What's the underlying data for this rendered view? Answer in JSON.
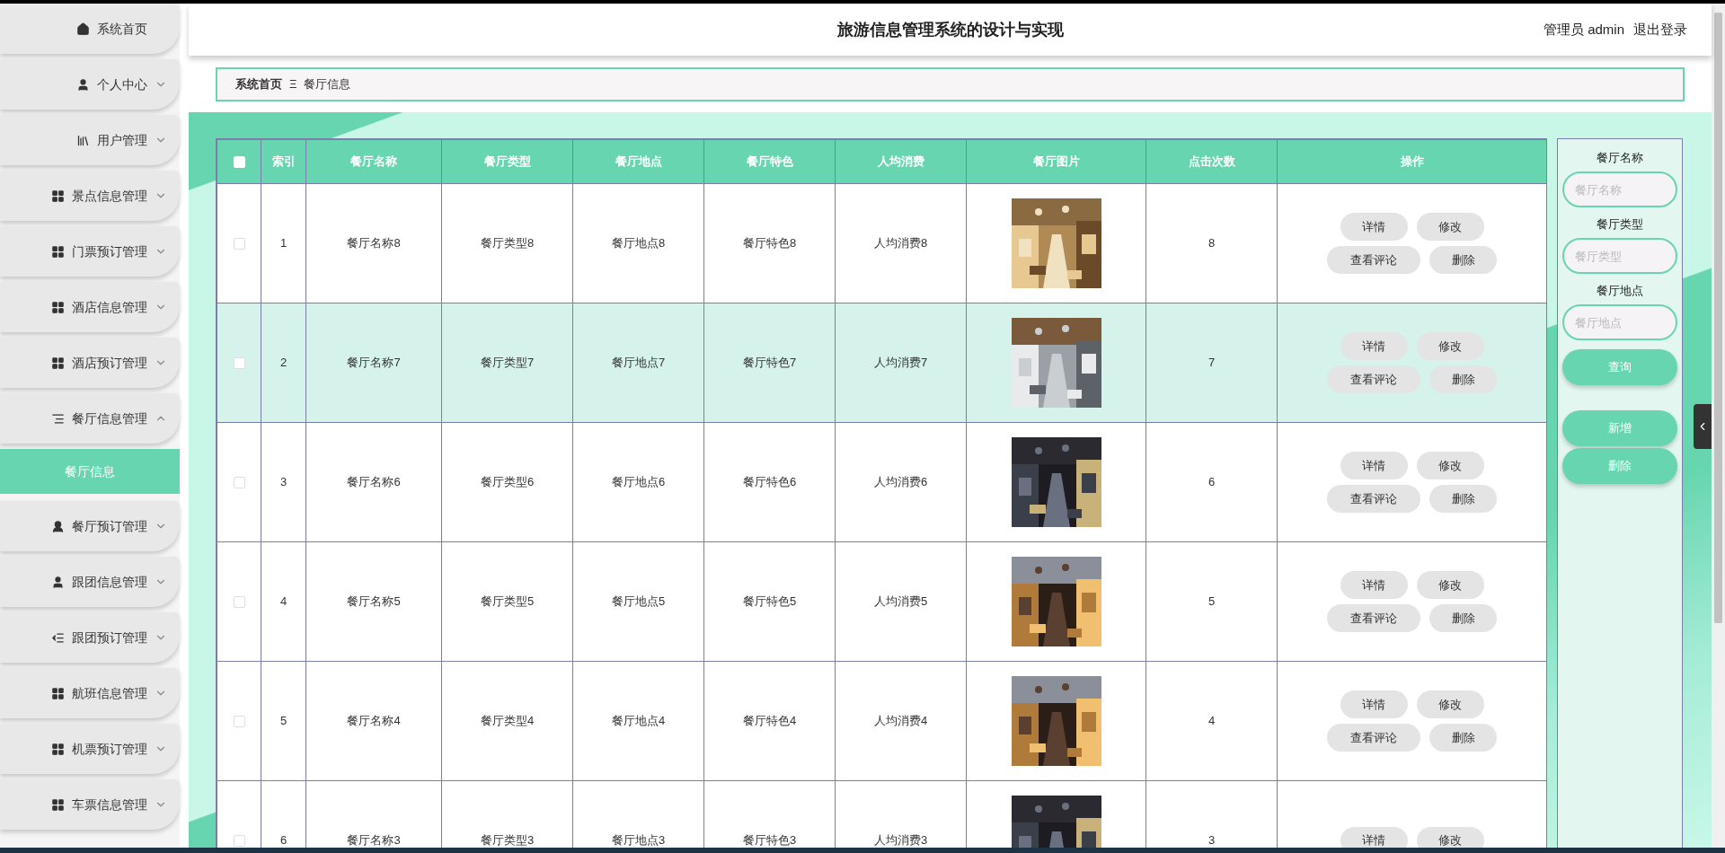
{
  "sidebar": {
    "items": [
      {
        "label": "系统首页",
        "kind": "link"
      },
      {
        "label": "个人中心",
        "kind": "menu",
        "expanded": false
      },
      {
        "label": "用户管理",
        "kind": "menu",
        "expanded": false
      },
      {
        "label": "景点信息管理",
        "kind": "menu",
        "expanded": false
      },
      {
        "label": "门票预订管理",
        "kind": "menu",
        "expanded": false
      },
      {
        "label": "酒店信息管理",
        "kind": "menu",
        "expanded": false
      },
      {
        "label": "酒店预订管理",
        "kind": "menu",
        "expanded": false
      },
      {
        "label": "餐厅信息管理",
        "kind": "menu",
        "expanded": true,
        "children": [
          {
            "label": "餐厅信息",
            "selected": true
          }
        ]
      },
      {
        "label": "餐厅预订管理",
        "kind": "menu",
        "expanded": false
      },
      {
        "label": "跟团信息管理",
        "kind": "menu",
        "expanded": false
      },
      {
        "label": "跟团预订管理",
        "kind": "menu",
        "expanded": false
      },
      {
        "label": "航班信息管理",
        "kind": "menu",
        "expanded": false
      },
      {
        "label": "机票预订管理",
        "kind": "menu",
        "expanded": false
      },
      {
        "label": "车票信息管理",
        "kind": "menu",
        "expanded": false
      }
    ]
  },
  "header": {
    "title": "旅游信息管理系统的设计与实现",
    "user": "管理员 admin",
    "logout": "退出登录"
  },
  "breadcrumb": {
    "items": [
      "系统首页",
      "餐厅信息"
    ],
    "separator": "Ξ"
  },
  "table": {
    "select_all": {
      "checked": false
    },
    "columns": [
      "索引",
      "餐厅名称",
      "餐厅类型",
      "餐厅地点",
      "餐厅特色",
      "人均消费",
      "餐厅图片",
      "点击次数",
      "操作"
    ],
    "rows": [
      {
        "checked": false,
        "hovered": false,
        "cells": [
          "1",
          "餐厅名称8",
          "餐厅类型8",
          "餐厅地点8",
          "餐厅特色8",
          "人均消费8",
          "8"
        ],
        "actions": [
          "详情",
          "修改",
          "查看评论",
          "删除"
        ]
      },
      {
        "checked": false,
        "hovered": true,
        "cells": [
          "2",
          "餐厅名称7",
          "餐厅类型7",
          "餐厅地点7",
          "餐厅特色7",
          "人均消费7",
          "7"
        ],
        "actions": [
          "详情",
          "修改",
          "查看评论",
          "删除"
        ]
      },
      {
        "checked": false,
        "hovered": false,
        "cells": [
          "3",
          "餐厅名称6",
          "餐厅类型6",
          "餐厅地点6",
          "餐厅特色6",
          "人均消费6",
          "6"
        ],
        "actions": [
          "详情",
          "修改",
          "查看评论",
          "删除"
        ]
      },
      {
        "checked": false,
        "hovered": false,
        "cells": [
          "4",
          "餐厅名称5",
          "餐厅类型5",
          "餐厅地点5",
          "餐厅特色5",
          "人均消费5",
          "5"
        ],
        "actions": [
          "详情",
          "修改",
          "查看评论",
          "删除"
        ]
      },
      {
        "checked": false,
        "hovered": false,
        "cells": [
          "5",
          "餐厅名称4",
          "餐厅类型4",
          "餐厅地点4",
          "餐厅特色4",
          "人均消费4",
          "4"
        ],
        "actions": [
          "详情",
          "修改",
          "查看评论",
          "删除"
        ]
      },
      {
        "checked": false,
        "hovered": false,
        "cells": [
          "6",
          "餐厅名称3",
          "餐厅类型3",
          "餐厅地点3",
          "餐厅特色3",
          "人均消费3",
          "3"
        ],
        "actions": [
          "详情",
          "修改"
        ]
      }
    ]
  },
  "search": {
    "fields": [
      {
        "label": "餐厅名称",
        "placeholder": "餐厅名称"
      },
      {
        "label": "餐厅类型",
        "placeholder": "餐厅类型"
      },
      {
        "label": "餐厅地点",
        "placeholder": "餐厅地点"
      }
    ],
    "buttons": [
      "查询",
      "新增",
      "删除"
    ]
  }
}
